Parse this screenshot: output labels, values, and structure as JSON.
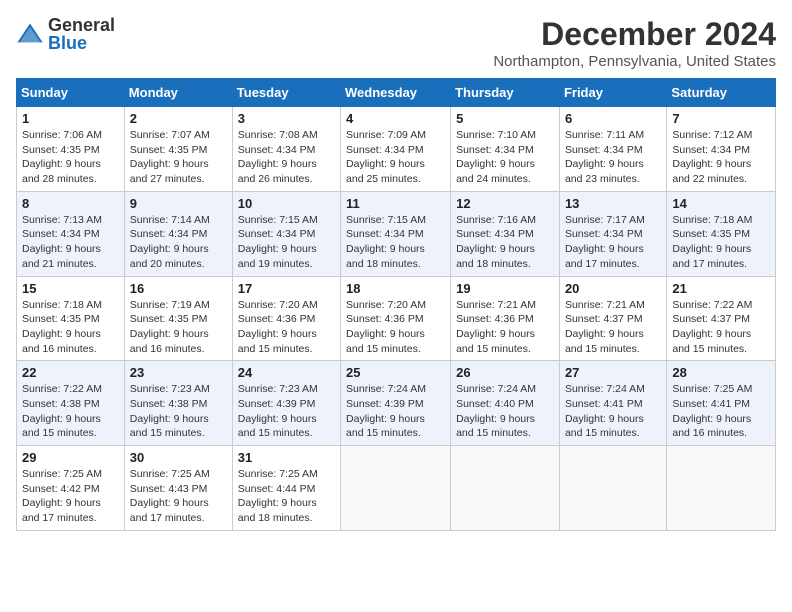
{
  "logo": {
    "general": "General",
    "blue": "Blue"
  },
  "title": "December 2024",
  "location": "Northampton, Pennsylvania, United States",
  "days_of_week": [
    "Sunday",
    "Monday",
    "Tuesday",
    "Wednesday",
    "Thursday",
    "Friday",
    "Saturday"
  ],
  "weeks": [
    [
      {
        "day": "1",
        "sunrise": "Sunrise: 7:06 AM",
        "sunset": "Sunset: 4:35 PM",
        "daylight": "Daylight: 9 hours and 28 minutes."
      },
      {
        "day": "2",
        "sunrise": "Sunrise: 7:07 AM",
        "sunset": "Sunset: 4:35 PM",
        "daylight": "Daylight: 9 hours and 27 minutes."
      },
      {
        "day": "3",
        "sunrise": "Sunrise: 7:08 AM",
        "sunset": "Sunset: 4:34 PM",
        "daylight": "Daylight: 9 hours and 26 minutes."
      },
      {
        "day": "4",
        "sunrise": "Sunrise: 7:09 AM",
        "sunset": "Sunset: 4:34 PM",
        "daylight": "Daylight: 9 hours and 25 minutes."
      },
      {
        "day": "5",
        "sunrise": "Sunrise: 7:10 AM",
        "sunset": "Sunset: 4:34 PM",
        "daylight": "Daylight: 9 hours and 24 minutes."
      },
      {
        "day": "6",
        "sunrise": "Sunrise: 7:11 AM",
        "sunset": "Sunset: 4:34 PM",
        "daylight": "Daylight: 9 hours and 23 minutes."
      },
      {
        "day": "7",
        "sunrise": "Sunrise: 7:12 AM",
        "sunset": "Sunset: 4:34 PM",
        "daylight": "Daylight: 9 hours and 22 minutes."
      }
    ],
    [
      {
        "day": "8",
        "sunrise": "Sunrise: 7:13 AM",
        "sunset": "Sunset: 4:34 PM",
        "daylight": "Daylight: 9 hours and 21 minutes."
      },
      {
        "day": "9",
        "sunrise": "Sunrise: 7:14 AM",
        "sunset": "Sunset: 4:34 PM",
        "daylight": "Daylight: 9 hours and 20 minutes."
      },
      {
        "day": "10",
        "sunrise": "Sunrise: 7:15 AM",
        "sunset": "Sunset: 4:34 PM",
        "daylight": "Daylight: 9 hours and 19 minutes."
      },
      {
        "day": "11",
        "sunrise": "Sunrise: 7:15 AM",
        "sunset": "Sunset: 4:34 PM",
        "daylight": "Daylight: 9 hours and 18 minutes."
      },
      {
        "day": "12",
        "sunrise": "Sunrise: 7:16 AM",
        "sunset": "Sunset: 4:34 PM",
        "daylight": "Daylight: 9 hours and 18 minutes."
      },
      {
        "day": "13",
        "sunrise": "Sunrise: 7:17 AM",
        "sunset": "Sunset: 4:34 PM",
        "daylight": "Daylight: 9 hours and 17 minutes."
      },
      {
        "day": "14",
        "sunrise": "Sunrise: 7:18 AM",
        "sunset": "Sunset: 4:35 PM",
        "daylight": "Daylight: 9 hours and 17 minutes."
      }
    ],
    [
      {
        "day": "15",
        "sunrise": "Sunrise: 7:18 AM",
        "sunset": "Sunset: 4:35 PM",
        "daylight": "Daylight: 9 hours and 16 minutes."
      },
      {
        "day": "16",
        "sunrise": "Sunrise: 7:19 AM",
        "sunset": "Sunset: 4:35 PM",
        "daylight": "Daylight: 9 hours and 16 minutes."
      },
      {
        "day": "17",
        "sunrise": "Sunrise: 7:20 AM",
        "sunset": "Sunset: 4:36 PM",
        "daylight": "Daylight: 9 hours and 15 minutes."
      },
      {
        "day": "18",
        "sunrise": "Sunrise: 7:20 AM",
        "sunset": "Sunset: 4:36 PM",
        "daylight": "Daylight: 9 hours and 15 minutes."
      },
      {
        "day": "19",
        "sunrise": "Sunrise: 7:21 AM",
        "sunset": "Sunset: 4:36 PM",
        "daylight": "Daylight: 9 hours and 15 minutes."
      },
      {
        "day": "20",
        "sunrise": "Sunrise: 7:21 AM",
        "sunset": "Sunset: 4:37 PM",
        "daylight": "Daylight: 9 hours and 15 minutes."
      },
      {
        "day": "21",
        "sunrise": "Sunrise: 7:22 AM",
        "sunset": "Sunset: 4:37 PM",
        "daylight": "Daylight: 9 hours and 15 minutes."
      }
    ],
    [
      {
        "day": "22",
        "sunrise": "Sunrise: 7:22 AM",
        "sunset": "Sunset: 4:38 PM",
        "daylight": "Daylight: 9 hours and 15 minutes."
      },
      {
        "day": "23",
        "sunrise": "Sunrise: 7:23 AM",
        "sunset": "Sunset: 4:38 PM",
        "daylight": "Daylight: 9 hours and 15 minutes."
      },
      {
        "day": "24",
        "sunrise": "Sunrise: 7:23 AM",
        "sunset": "Sunset: 4:39 PM",
        "daylight": "Daylight: 9 hours and 15 minutes."
      },
      {
        "day": "25",
        "sunrise": "Sunrise: 7:24 AM",
        "sunset": "Sunset: 4:39 PM",
        "daylight": "Daylight: 9 hours and 15 minutes."
      },
      {
        "day": "26",
        "sunrise": "Sunrise: 7:24 AM",
        "sunset": "Sunset: 4:40 PM",
        "daylight": "Daylight: 9 hours and 15 minutes."
      },
      {
        "day": "27",
        "sunrise": "Sunrise: 7:24 AM",
        "sunset": "Sunset: 4:41 PM",
        "daylight": "Daylight: 9 hours and 15 minutes."
      },
      {
        "day": "28",
        "sunrise": "Sunrise: 7:25 AM",
        "sunset": "Sunset: 4:41 PM",
        "daylight": "Daylight: 9 hours and 16 minutes."
      }
    ],
    [
      {
        "day": "29",
        "sunrise": "Sunrise: 7:25 AM",
        "sunset": "Sunset: 4:42 PM",
        "daylight": "Daylight: 9 hours and 17 minutes."
      },
      {
        "day": "30",
        "sunrise": "Sunrise: 7:25 AM",
        "sunset": "Sunset: 4:43 PM",
        "daylight": "Daylight: 9 hours and 17 minutes."
      },
      {
        "day": "31",
        "sunrise": "Sunrise: 7:25 AM",
        "sunset": "Sunset: 4:44 PM",
        "daylight": "Daylight: 9 hours and 18 minutes."
      },
      null,
      null,
      null,
      null
    ]
  ]
}
